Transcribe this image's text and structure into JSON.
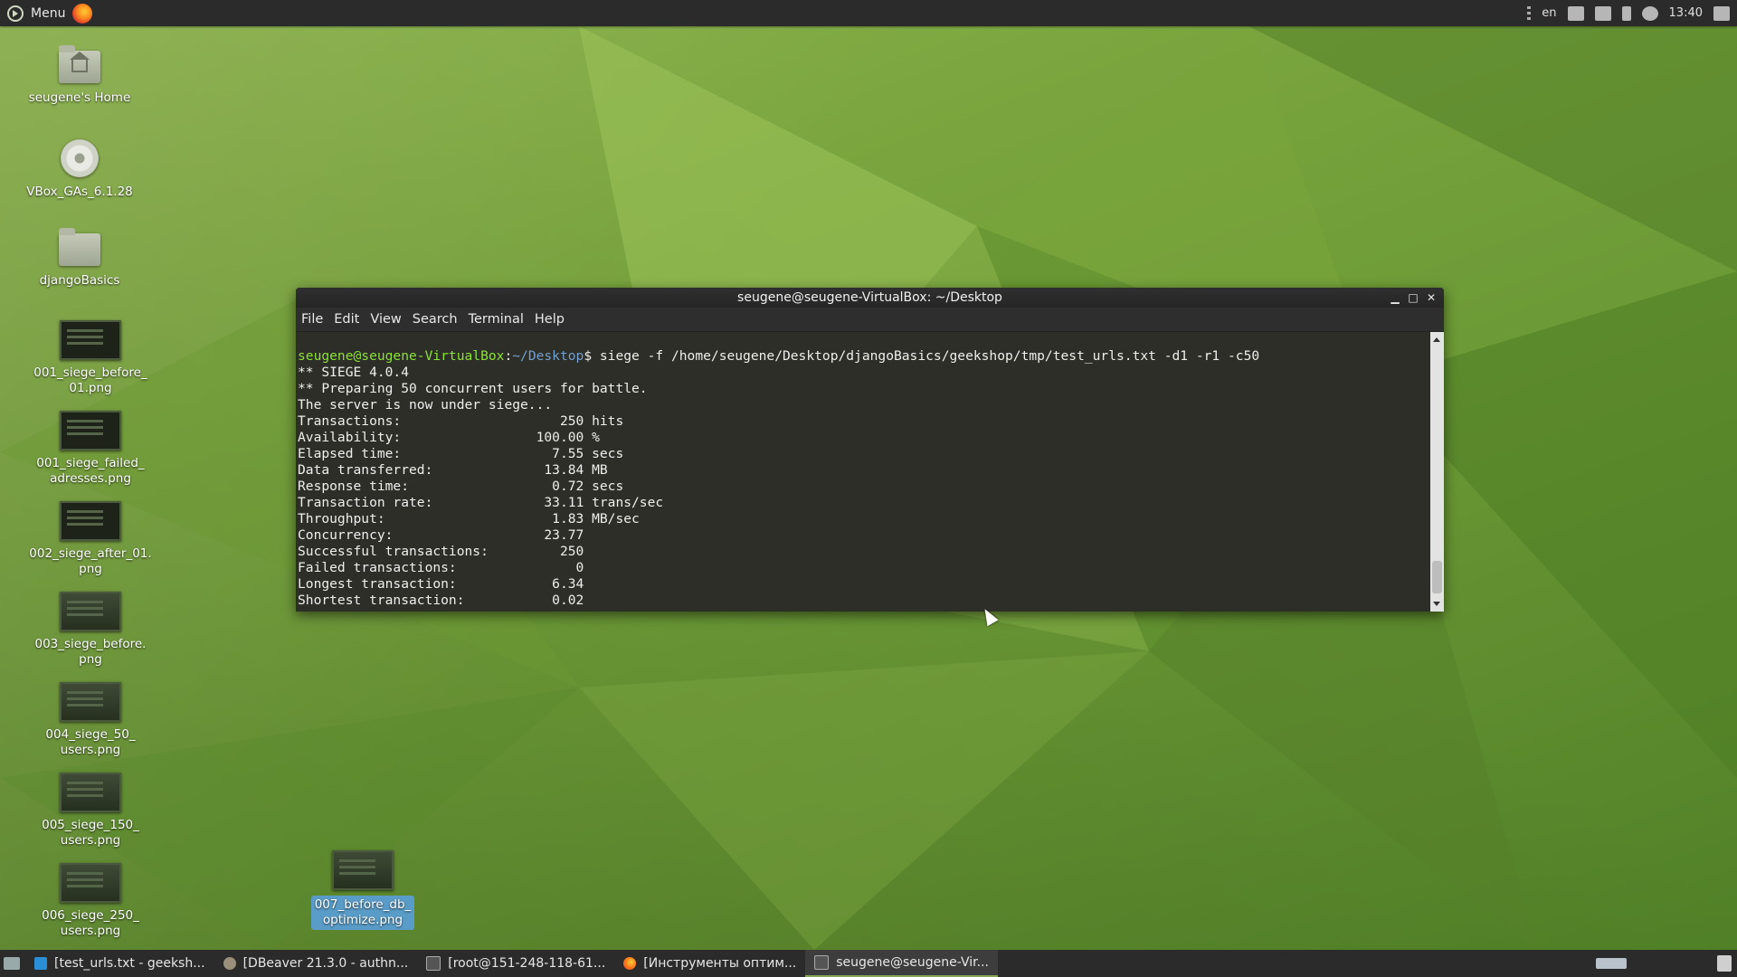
{
  "top_panel": {
    "menu_label": "Menu",
    "keyboard_layout": "en",
    "clock": "13:40",
    "tray_icons": [
      "dots-handle-icon",
      "nvidia-icon",
      "network-icon",
      "update-icon",
      "volume-icon",
      "display-icon"
    ]
  },
  "desktop_icons": [
    {
      "name": "home-folder",
      "label": "seugene's Home",
      "icon": "home-folder-icon"
    },
    {
      "name": "vbox-disc",
      "label": "VBox_GAs_6.1.28",
      "icon": "disc-icon"
    },
    {
      "name": "django-folder",
      "label": "djangoBasics",
      "icon": "folder-icon"
    },
    {
      "name": "file-001-before",
      "label": "001_siege_before_\n01.png",
      "icon": "image-icon"
    },
    {
      "name": "file-001-failed",
      "label": "001_siege_failed_\nadresses.png",
      "icon": "image-icon"
    },
    {
      "name": "file-002-after",
      "label": "002_siege_after_01.\npng",
      "icon": "image-icon"
    },
    {
      "name": "file-003-before",
      "label": "003_siege_before.\npng",
      "icon": "image-icon"
    },
    {
      "name": "file-004-50",
      "label": "004_siege_50_\nusers.png",
      "icon": "image-icon"
    },
    {
      "name": "file-005-150",
      "label": "005_siege_150_\nusers.png",
      "icon": "image-icon"
    },
    {
      "name": "file-006-250",
      "label": "006_siege_250_\nusers.png",
      "icon": "image-icon"
    },
    {
      "name": "file-007-before-db",
      "label": "007_before_db_\noptimize.png",
      "icon": "image-icon"
    }
  ],
  "terminal": {
    "title": "seugene@seugene-VirtualBox: ~/Desktop",
    "menu": [
      "File",
      "Edit",
      "View",
      "Search",
      "Terminal",
      "Help"
    ],
    "prompt_user": "seugene@seugene-VirtualBox",
    "prompt_sep": ":",
    "prompt_path": "~/Desktop",
    "command": "$ siege -f /home/seugene/Desktop/djangoBasics/geekshop/tmp/test_urls.txt -d1 -r1 -c50",
    "output": [
      "** SIEGE 4.0.4",
      "** Preparing 50 concurrent users for battle.",
      "The server is now under siege...",
      "Transactions:                    250 hits",
      "Availability:                 100.00 %",
      "Elapsed time:                   7.55 secs",
      "Data transferred:              13.84 MB",
      "Response time:                  0.72 secs",
      "Transaction rate:              33.11 trans/sec",
      "Throughput:                     1.83 MB/sec",
      "Concurrency:                   23.77",
      "Successful transactions:         250",
      "Failed transactions:               0",
      "Longest transaction:            6.34",
      "Shortest transaction:           0.02"
    ]
  },
  "taskbar": {
    "tasks": [
      {
        "label": "[test_urls.txt - geeksh...",
        "icon": "vscode-icon",
        "active": false
      },
      {
        "label": "[DBeaver 21.3.0 - authn...",
        "icon": "dbeaver-icon",
        "active": false
      },
      {
        "label": "[root@151-248-118-61...",
        "icon": "terminal-icon",
        "active": false
      },
      {
        "label": "[Инструменты оптим...",
        "icon": "firefox-icon",
        "active": false
      },
      {
        "label": "seugene@seugene-Vir...",
        "icon": "terminal-icon",
        "active": true
      }
    ]
  }
}
